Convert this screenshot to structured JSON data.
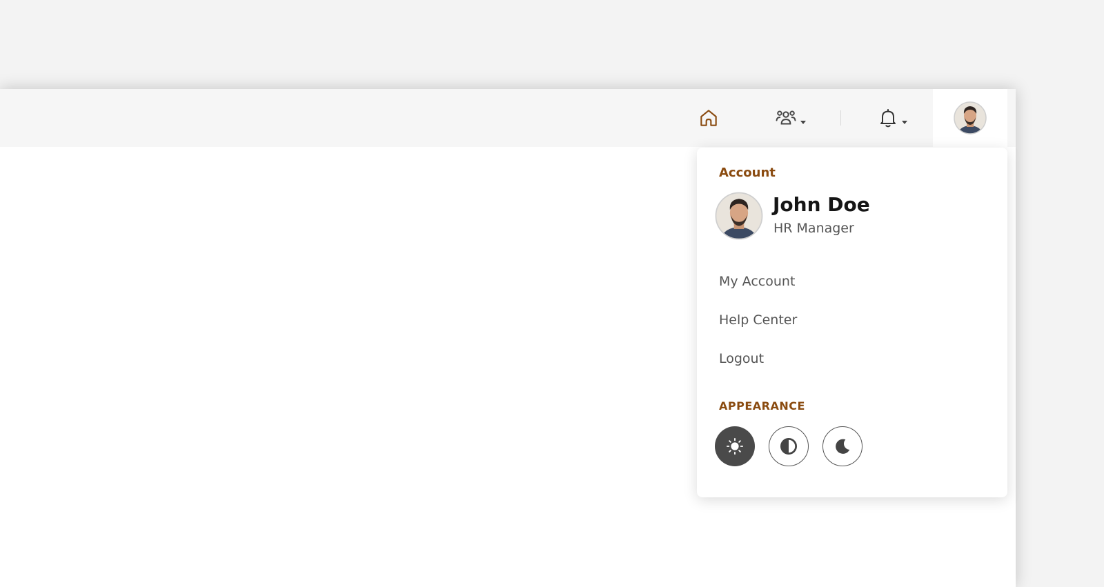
{
  "topbar": {
    "icons": {
      "home": "home-icon",
      "team": "team-icon",
      "notifications": "bell-icon",
      "avatar": "user-avatar"
    }
  },
  "dropdown": {
    "section_title": "Account",
    "user": {
      "name": "John Doe",
      "role": "HR Manager"
    },
    "menu": [
      {
        "label": "My Account"
      },
      {
        "label": "Help Center"
      },
      {
        "label": "Logout"
      }
    ],
    "appearance_title": "APPEARANCE",
    "appearance_options": [
      {
        "icon": "sun-icon",
        "selected": true
      },
      {
        "icon": "contrast-icon",
        "selected": false
      },
      {
        "icon": "moon-icon",
        "selected": false
      }
    ]
  },
  "colors": {
    "accent": "#8a4b10",
    "topbar_bg": "#f6f6f6",
    "page_bg": "#f3f3f3",
    "selected_theme_bg": "#4a4a4a"
  }
}
